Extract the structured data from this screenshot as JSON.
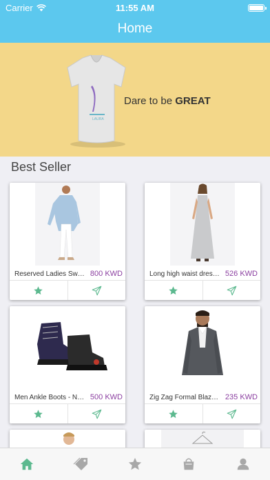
{
  "status_bar": {
    "carrier": "Carrier",
    "time": "11:55 AM"
  },
  "nav": {
    "title": "Home"
  },
  "banner": {
    "text_prefix": "Dare to be ",
    "text_bold": "GREAT"
  },
  "section": {
    "title": "Best Seller"
  },
  "products": [
    {
      "name": "Reserved Ladies Sweat...",
      "price": "800 KWD"
    },
    {
      "name": "Long high waist dress...",
      "price": "526 KWD"
    },
    {
      "name": "Men Ankle Boots - Na...",
      "price": "500 KWD"
    },
    {
      "name": "Zig Zag Formal Blazer...",
      "price": "235 KWD"
    }
  ],
  "colors": {
    "accent": "#5cc8ee",
    "banner": "#f3d789",
    "price": "#8b3fa0",
    "icon": "#5cb98f",
    "tab_inactive": "#a8a8a8"
  },
  "tabs": [
    {
      "icon": "home-icon"
    },
    {
      "icon": "tag-icon"
    },
    {
      "icon": "star-icon"
    },
    {
      "icon": "shopping-bag-icon"
    },
    {
      "icon": "profile-icon"
    }
  ]
}
